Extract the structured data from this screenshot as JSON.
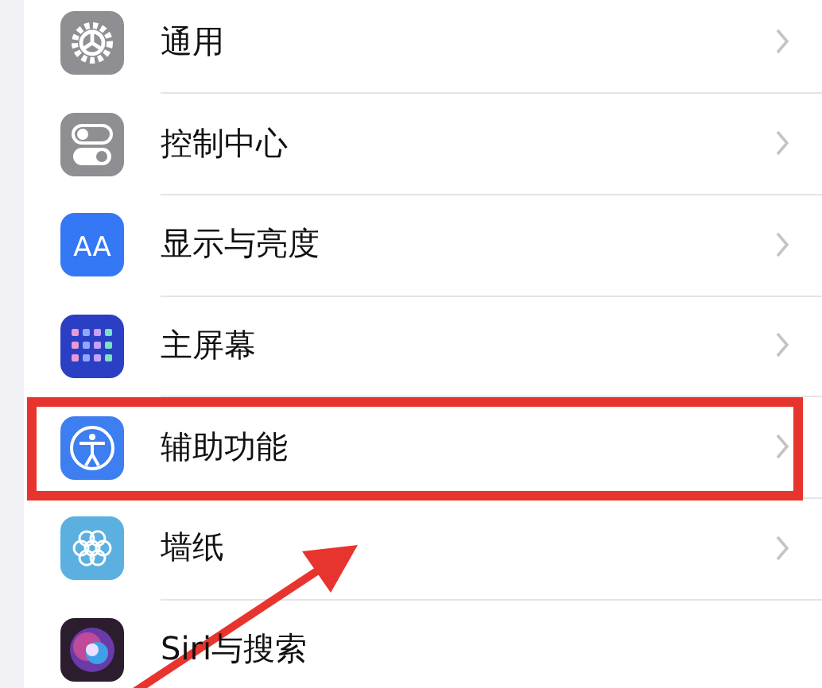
{
  "settings_rows": [
    {
      "kind": "gear",
      "label": "通用",
      "chevron": true,
      "highlighted": false
    },
    {
      "kind": "toggles",
      "label": "控制中心",
      "chevron": true,
      "highlighted": false
    },
    {
      "kind": "letters",
      "icon_text": "AA",
      "label": "显示与亮度",
      "chevron": true,
      "highlighted": false
    },
    {
      "kind": "grid",
      "label": "主屏幕",
      "chevron": true,
      "highlighted": false
    },
    {
      "kind": "person",
      "label": "辅助功能",
      "chevron": true,
      "highlighted": true
    },
    {
      "kind": "flower",
      "label": "墙纸",
      "chevron": true,
      "highlighted": false
    },
    {
      "kind": "orb",
      "label": "Siri与搜索",
      "chevron": false,
      "highlighted": false
    }
  ],
  "annotation": {
    "arrow": true
  }
}
